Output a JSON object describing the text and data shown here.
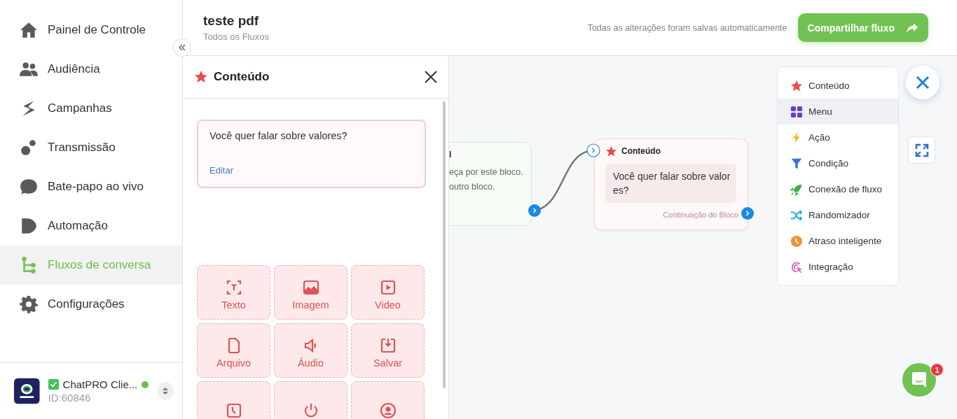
{
  "sidebar": {
    "items": [
      {
        "label": "Painel de Controle",
        "kind": "home",
        "selected": false
      },
      {
        "label": "Audiência",
        "kind": "people",
        "selected": false
      },
      {
        "label": "Campanhas",
        "kind": "campaign",
        "selected": false
      },
      {
        "label": "Transmissão",
        "kind": "broadcast",
        "selected": false
      },
      {
        "label": "Bate-papo ao vivo",
        "kind": "chat",
        "selected": false
      },
      {
        "label": "Automação",
        "kind": "automation",
        "selected": false
      },
      {
        "label": "Fluxos de conversa",
        "kind": "flow",
        "selected": true
      },
      {
        "label": "Configurações",
        "kind": "settings",
        "selected": false
      }
    ],
    "account": {
      "name": "ChatPRO Clie...",
      "id": "ID:60846",
      "verified": true,
      "online": true
    }
  },
  "header": {
    "title": "teste pdf",
    "subtitle": "Todos os Fluxos",
    "autosave_text": "Todas as alterações foram salvas automaticamente",
    "share_button": "Compartilhar fluxo"
  },
  "panel": {
    "title": "Conteúdo",
    "message": {
      "text": "Você quer falar sobre valores?",
      "link": "Editar"
    },
    "tiles": [
      {
        "label": "Texto",
        "kind": "text"
      },
      {
        "label": "Imagem",
        "kind": "image"
      },
      {
        "label": "Video",
        "kind": "video"
      },
      {
        "label": "Arquivo",
        "kind": "file"
      },
      {
        "label": "Áudio",
        "kind": "audio"
      },
      {
        "label": "Salvar",
        "kind": "save"
      },
      {
        "kind": "clock"
      },
      {
        "kind": "power"
      },
      {
        "kind": "contact"
      }
    ]
  },
  "canvas": {
    "partial_node": {
      "title": "l",
      "lines": [
        "eça por este bloco.",
        "outro bloco."
      ]
    },
    "node": {
      "title": "Conteúdo",
      "message": "Você quer falar sobre valores?",
      "footer": "Continuação do Bloco"
    },
    "add_menu": [
      {
        "label": "Conteúdo",
        "kind": "content",
        "selected": false
      },
      {
        "label": "Menu",
        "kind": "menu",
        "selected": true
      },
      {
        "label": "Ação",
        "kind": "action",
        "selected": false
      },
      {
        "label": "Condição",
        "kind": "condition",
        "selected": false
      },
      {
        "label": "Conexão de fluxo",
        "kind": "connection",
        "selected": false
      },
      {
        "label": "Randomizador",
        "kind": "random",
        "selected": false
      },
      {
        "label": "Atraso inteligente",
        "kind": "delay",
        "selected": false
      },
      {
        "label": "Integração",
        "kind": "integration",
        "selected": false
      }
    ]
  },
  "chat_badge": "1"
}
